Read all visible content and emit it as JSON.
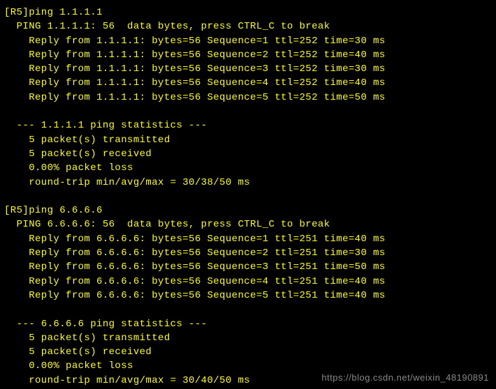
{
  "terminal": {
    "blocks": [
      {
        "prompt": "[R5]ping 1.1.1.1",
        "header": "  PING 1.1.1.1: 56  data bytes, press CTRL_C to break",
        "replies": [
          "    Reply from 1.1.1.1: bytes=56 Sequence=1 ttl=252 time=30 ms",
          "    Reply from 1.1.1.1: bytes=56 Sequence=2 ttl=252 time=40 ms",
          "    Reply from 1.1.1.1: bytes=56 Sequence=3 ttl=252 time=30 ms",
          "    Reply from 1.1.1.1: bytes=56 Sequence=4 ttl=252 time=40 ms",
          "    Reply from 1.1.1.1: bytes=56 Sequence=5 ttl=252 time=50 ms"
        ],
        "stats_header": "  --- 1.1.1.1 ping statistics ---",
        "stats": [
          "    5 packet(s) transmitted",
          "    5 packet(s) received",
          "    0.00% packet loss",
          "    round-trip min/avg/max = 30/38/50 ms"
        ]
      },
      {
        "prompt": "[R5]ping 6.6.6.6",
        "header": "  PING 6.6.6.6: 56  data bytes, press CTRL_C to break",
        "replies": [
          "    Reply from 6.6.6.6: bytes=56 Sequence=1 ttl=251 time=40 ms",
          "    Reply from 6.6.6.6: bytes=56 Sequence=2 ttl=251 time=30 ms",
          "    Reply from 6.6.6.6: bytes=56 Sequence=3 ttl=251 time=50 ms",
          "    Reply from 6.6.6.6: bytes=56 Sequence=4 ttl=251 time=40 ms",
          "    Reply from 6.6.6.6: bytes=56 Sequence=5 ttl=251 time=40 ms"
        ],
        "stats_header": "  --- 6.6.6.6 ping statistics ---",
        "stats": [
          "    5 packet(s) transmitted",
          "    5 packet(s) received",
          "    0.00% packet loss",
          "    round-trip min/avg/max = 30/40/50 ms"
        ]
      }
    ]
  },
  "watermark": "https://blog.csdn.net/weixin_48190891"
}
